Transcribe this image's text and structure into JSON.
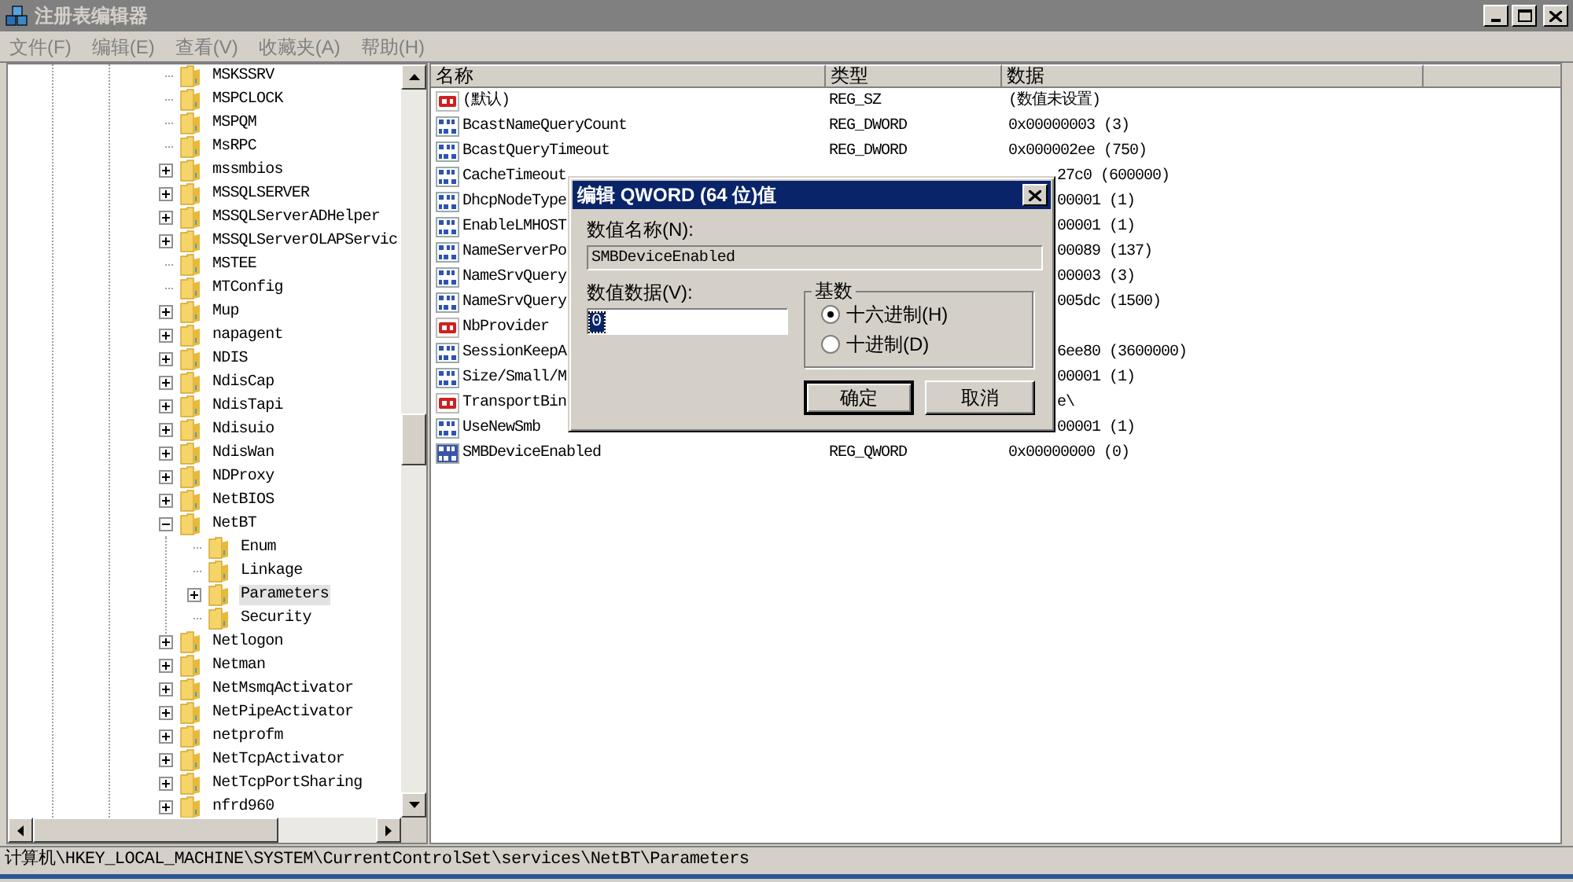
{
  "window": {
    "title": "注册表编辑器"
  },
  "menu": [
    {
      "label": "文件(F)"
    },
    {
      "label": "编辑(E)"
    },
    {
      "label": "查看(V)"
    },
    {
      "label": "收藏夹(A)"
    },
    {
      "label": "帮助(H)"
    }
  ],
  "tree": {
    "items": [
      {
        "label": "MSKSSRV",
        "expandable": false,
        "selected": false
      },
      {
        "label": "MSPCLOCK",
        "expandable": false,
        "selected": false
      },
      {
        "label": "MSPQM",
        "expandable": false,
        "selected": false
      },
      {
        "label": "MsRPC",
        "expandable": false,
        "selected": false
      },
      {
        "label": "mssmbios",
        "expandable": true,
        "expanded": false,
        "selected": false
      },
      {
        "label": "MSSQLSERVER",
        "expandable": true,
        "expanded": false,
        "selected": false
      },
      {
        "label": "MSSQLServerADHelper",
        "expandable": true,
        "expanded": false,
        "selected": false
      },
      {
        "label": "MSSQLServerOLAPServic",
        "expandable": true,
        "expanded": false,
        "selected": false
      },
      {
        "label": "MSTEE",
        "expandable": false,
        "selected": false
      },
      {
        "label": "MTConfig",
        "expandable": false,
        "selected": false
      },
      {
        "label": "Mup",
        "expandable": true,
        "expanded": false,
        "selected": false
      },
      {
        "label": "napagent",
        "expandable": true,
        "expanded": false,
        "selected": false
      },
      {
        "label": "NDIS",
        "expandable": true,
        "expanded": false,
        "selected": false
      },
      {
        "label": "NdisCap",
        "expandable": true,
        "expanded": false,
        "selected": false
      },
      {
        "label": "NdisTapi",
        "expandable": true,
        "expanded": false,
        "selected": false
      },
      {
        "label": "Ndisuio",
        "expandable": true,
        "expanded": false,
        "selected": false
      },
      {
        "label": "NdisWan",
        "expandable": true,
        "expanded": false,
        "selected": false
      },
      {
        "label": "NDProxy",
        "expandable": true,
        "expanded": false,
        "selected": false
      },
      {
        "label": "NetBIOS",
        "expandable": true,
        "expanded": false,
        "selected": false
      },
      {
        "label": "NetBT",
        "expandable": true,
        "expanded": true,
        "selected": false,
        "children": [
          {
            "label": "Enum",
            "expandable": false,
            "selected": false
          },
          {
            "label": "Linkage",
            "expandable": false,
            "selected": false
          },
          {
            "label": "Parameters",
            "expandable": true,
            "expanded": false,
            "selected": true
          },
          {
            "label": "Security",
            "expandable": false,
            "selected": false
          }
        ]
      },
      {
        "label": "Netlogon",
        "expandable": true,
        "expanded": false,
        "selected": false
      },
      {
        "label": "Netman",
        "expandable": true,
        "expanded": false,
        "selected": false
      },
      {
        "label": "NetMsmqActivator",
        "expandable": true,
        "expanded": false,
        "selected": false
      },
      {
        "label": "NetPipeActivator",
        "expandable": true,
        "expanded": false,
        "selected": false
      },
      {
        "label": "netprofm",
        "expandable": true,
        "expanded": false,
        "selected": false
      },
      {
        "label": "NetTcpActivator",
        "expandable": true,
        "expanded": false,
        "selected": false
      },
      {
        "label": "NetTcpPortSharing",
        "expandable": true,
        "expanded": false,
        "selected": false
      },
      {
        "label": "nfrd960",
        "expandable": true,
        "expanded": false,
        "selected": false
      }
    ]
  },
  "list": {
    "columns": [
      "名称",
      "类型",
      "数据"
    ],
    "rows": [
      {
        "kind": "string",
        "name": "(默认)",
        "type": "REG_SZ",
        "data": "(数值未设置)",
        "covered": false,
        "selected": false
      },
      {
        "kind": "binary",
        "name": "BcastNameQueryCount",
        "type": "REG_DWORD",
        "data": "0x00000003 (3)",
        "covered": false,
        "selected": false
      },
      {
        "kind": "binary",
        "name": "BcastQueryTimeout",
        "type": "REG_DWORD",
        "data": "0x000002ee (750)",
        "covered": false,
        "selected": false
      },
      {
        "kind": "binary",
        "name": "CacheTimeout",
        "data": "27c0 (600000)",
        "covered": true,
        "selected": false
      },
      {
        "kind": "binary",
        "name": "DhcpNodeType",
        "data": "00001 (1)",
        "covered": true,
        "selected": false
      },
      {
        "kind": "binary",
        "name": "EnableLMHOST",
        "data": "00001 (1)",
        "covered": true,
        "selected": false
      },
      {
        "kind": "binary",
        "name": "NameServerPo",
        "data": "00089 (137)",
        "covered": true,
        "selected": false
      },
      {
        "kind": "binary",
        "name": "NameSrvQuery",
        "data": "00003 (3)",
        "covered": true,
        "selected": false
      },
      {
        "kind": "binary",
        "name": "NameSrvQuery",
        "data": "005dc (1500)",
        "covered": true,
        "selected": false
      },
      {
        "kind": "string",
        "name": "NbProvider",
        "selected": false
      },
      {
        "kind": "binary",
        "name": "SessionKeepA",
        "data": "6ee80 (3600000)",
        "covered": true,
        "selected": false
      },
      {
        "kind": "binary",
        "name": "Size/Small/M",
        "data": "00001 (1)",
        "covered": true,
        "selected": false
      },
      {
        "kind": "string",
        "name": "TransportBin",
        "data": "e\\",
        "covered": true,
        "selected": false
      },
      {
        "kind": "binary",
        "name": "UseNewSmb",
        "data": "00001 (1)",
        "covered": true,
        "selected": false
      },
      {
        "kind": "binary",
        "name": "SMBDeviceEnabled",
        "type": "REG_QWORD",
        "data": "0x00000000 (0)",
        "covered": false,
        "selected": true
      }
    ]
  },
  "dialog": {
    "title": "编辑 QWORD (64 位)值",
    "name_label": "数值名称(N):",
    "name_value": "SMBDeviceEnabled",
    "data_label": "数值数据(V):",
    "data_value": "0",
    "base_label": "基数",
    "radios": [
      {
        "label": "十六进制(H)",
        "selected": true
      },
      {
        "label": "十进制(D)",
        "selected": false
      }
    ],
    "buttons": [
      {
        "label": "确定",
        "default": true
      },
      {
        "label": "取消",
        "default": false
      }
    ]
  },
  "status_bar": "计算机\\HKEY_LOCAL_MACHINE\\SYSTEM\\CurrentControlSet\\services\\NetBT\\Parameters"
}
